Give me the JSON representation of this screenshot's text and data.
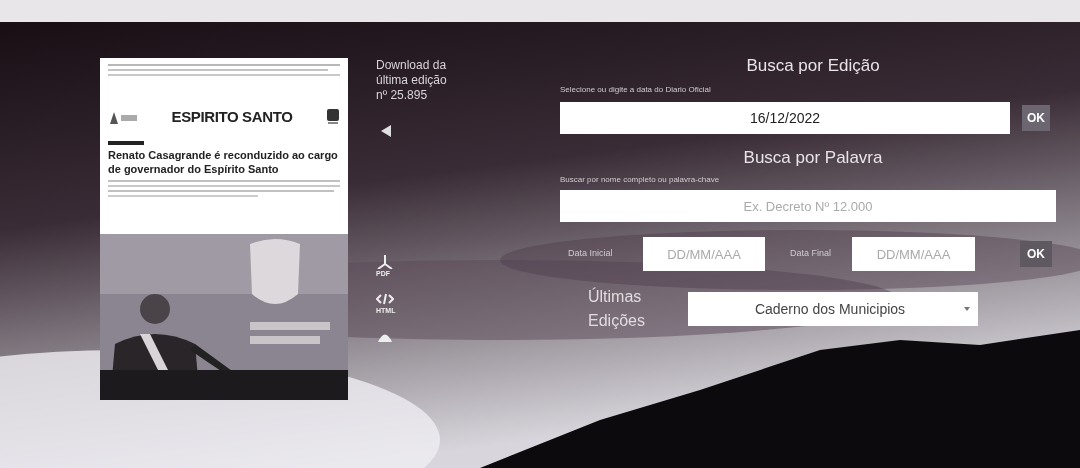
{
  "cover": {
    "masthead": "ESPIRITO SANTO",
    "headline": "Renato Casagrande é reconduzido ao cargo de governador do Espírito Santo"
  },
  "download": {
    "text": "Download da última edição nº 25.895"
  },
  "formats": [
    {
      "kind": "pdf",
      "label": "PDF"
    },
    {
      "kind": "html",
      "label": "HTML"
    },
    {
      "kind": "dome"
    }
  ],
  "edition_search": {
    "title": "Busca por Edição",
    "label": "Selecione ou digite a data do Diario Oficial",
    "value": "16/12/2022",
    "button": "OK"
  },
  "word_search": {
    "title": "Busca por Palavra",
    "label": "Buscar por nome completo ou palavra-chave",
    "placeholder": "Ex. Decreto Nº 12.000",
    "start_label": "Data Inicial",
    "start_placeholder": "DD/MM/AAA",
    "end_label": "Data Final",
    "end_placeholder": "DD/MM/AAA",
    "button": "OK"
  },
  "latest": {
    "label": "Últimas Edições",
    "value": "Caderno dos Municipios"
  }
}
